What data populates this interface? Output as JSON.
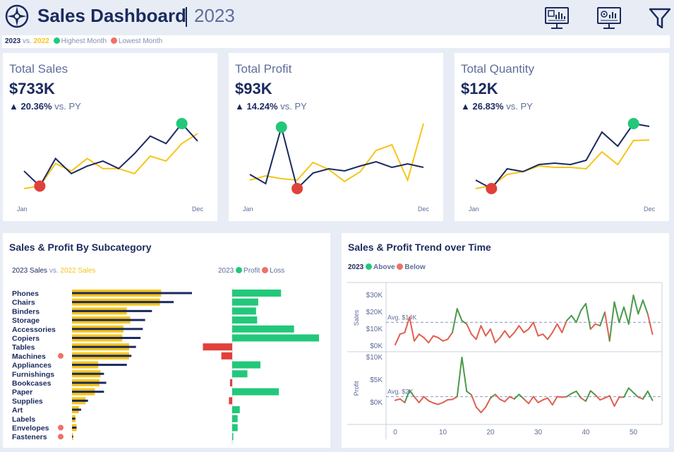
{
  "header": {
    "title": "Sales Dashboard",
    "year": "2023",
    "icons": [
      "compass-logo-icon",
      "dashboard-monitor-icon",
      "settings-monitor-icon",
      "filter-icon"
    ]
  },
  "legend": {
    "current": "2023",
    "vs": "vs.",
    "previous": "2022",
    "highest": "Highest Month",
    "lowest": "Lowest Month"
  },
  "colors": {
    "navy": "#1b2a5e",
    "yellow": "#f5c518",
    "green": "#22c87a",
    "red": "#e0413a",
    "trend_green": "#4a9a4a",
    "trend_red": "#e06050"
  },
  "kpis": [
    {
      "title": "Total Sales",
      "value": "$733K",
      "change_arrow": "▲",
      "change": "20.36%",
      "vs": "vs. PY",
      "start_label": "Jan",
      "end_label": "Dec",
      "cy": [
        3.1,
        2.5,
        3.6,
        3.0,
        3.3,
        3.5,
        3.2,
        3.8,
        4.5,
        4.2,
        5.0,
        4.3
      ],
      "py": [
        2.4,
        2.5,
        3.4,
        3.1,
        3.6,
        3.2,
        3.2,
        3.0,
        3.7,
        3.5,
        4.2,
        4.6
      ],
      "high": 10,
      "low": 1
    },
    {
      "title": "Total Profit",
      "value": "$93K",
      "change_arrow": "▲",
      "change": "14.24%",
      "vs": "vs. PY",
      "start_label": "Jan",
      "end_label": "Dec",
      "cy": [
        3.8,
        2.5,
        10.5,
        1.8,
        4.0,
        4.6,
        4.3,
        5.0,
        5.6,
        4.8,
        5.3,
        4.8
      ],
      "py": [
        3.0,
        3.6,
        3.2,
        3.0,
        5.5,
        4.5,
        2.8,
        4.2,
        7.2,
        8.0,
        3.0,
        11.0
      ],
      "high": 2,
      "low": 3
    },
    {
      "title": "Total Quantity",
      "value": "$12K",
      "change_arrow": "▲",
      "change": "26.83%",
      "vs": "vs. PY",
      "start_label": "Jan",
      "end_label": "Dec",
      "cy": [
        1.2,
        0.9,
        1.6,
        1.5,
        1.75,
        1.8,
        1.75,
        1.9,
        2.9,
        2.4,
        3.2,
        3.1
      ],
      "py": [
        0.9,
        1.0,
        1.4,
        1.5,
        1.7,
        1.65,
        1.65,
        1.6,
        2.2,
        1.75,
        2.6,
        2.62
      ],
      "high": 10,
      "low": 1
    }
  ],
  "subcategory": {
    "title": "Sales & Profit By Subcategory",
    "sales_legend": {
      "current": "2023 Sales",
      "vs": "vs.",
      "previous": "2022 Sales"
    },
    "profit_legend": {
      "year": "2023",
      "profit": "Profit",
      "loss": "Loss"
    },
    "items": [
      {
        "name": "Phones",
        "s23": 105,
        "s22": 78,
        "profit": 45,
        "flag": false
      },
      {
        "name": "Chairs",
        "s23": 89,
        "s22": 77,
        "profit": 24,
        "flag": false
      },
      {
        "name": "Binders",
        "s23": 70,
        "s22": 48,
        "profit": 22,
        "flag": false
      },
      {
        "name": "Storage",
        "s23": 64,
        "s22": 51,
        "profit": 23,
        "flag": false
      },
      {
        "name": "Accessories",
        "s23": 62,
        "s22": 45,
        "profit": 57,
        "flag": false
      },
      {
        "name": "Copiers",
        "s23": 60,
        "s22": 44,
        "profit": 80,
        "flag": false
      },
      {
        "name": "Tables",
        "s23": 56,
        "s22": 50,
        "profit": -27,
        "flag": false
      },
      {
        "name": "Machines",
        "s23": 52,
        "s22": 50,
        "profit": -10,
        "flag": true
      },
      {
        "name": "Appliances",
        "s23": 48,
        "s22": 23,
        "profit": 26,
        "flag": false
      },
      {
        "name": "Furnishings",
        "s23": 28,
        "s22": 25,
        "profit": 14,
        "flag": false
      },
      {
        "name": "Bookcases",
        "s23": 30,
        "s22": 24,
        "profit": -2,
        "flag": false
      },
      {
        "name": "Paper",
        "s23": 28,
        "s22": 20,
        "profit": 43,
        "flag": false
      },
      {
        "name": "Supplies",
        "s23": 14,
        "s22": 12,
        "profit": -3,
        "flag": false
      },
      {
        "name": "Art",
        "s23": 8,
        "s22": 6,
        "profit": 7,
        "flag": false
      },
      {
        "name": "Labels",
        "s23": 3,
        "s22": 3,
        "profit": 5,
        "flag": false
      },
      {
        "name": "Envelopes",
        "s23": 4,
        "s22": 4,
        "profit": 5,
        "flag": true
      },
      {
        "name": "Fasteners",
        "s23": 1,
        "s22": 1,
        "profit": 1,
        "flag": true
      }
    ]
  },
  "trend": {
    "title": "Sales & Profit Trend over Time",
    "legend": {
      "year": "2023",
      "above": "Above",
      "below": "Below"
    },
    "sales_axis_label": "Sales",
    "profit_axis_label": "Profit",
    "sales_ticks": [
      "$30K",
      "$20K",
      "$10K",
      "$0K"
    ],
    "profit_ticks": [
      "$10K",
      "$5K",
      "$0K"
    ],
    "x_ticks": [
      "0",
      "10",
      "20",
      "30",
      "40",
      "50"
    ],
    "sales_avg_label": "Avg. $14K",
    "profit_avg_label": "Avg. $2K",
    "sales_avg": 14,
    "profit_avg": 1.3,
    "sales": [
      0.8,
      7,
      8,
      17,
      3,
      7,
      5,
      2,
      6,
      5,
      3,
      4,
      8,
      22,
      15,
      13,
      7,
      4,
      12,
      6,
      10,
      2,
      5,
      9,
      5,
      8,
      12,
      8,
      10,
      14,
      6,
      7,
      4,
      8,
      13,
      8,
      15,
      18,
      14,
      21,
      25,
      10,
      13,
      12,
      20,
      3,
      26,
      14,
      23,
      13,
      30,
      19,
      27,
      19,
      7
    ],
    "profit": [
      0.5,
      0.8,
      0,
      2.7,
      1.3,
      0,
      1.3,
      0.4,
      -0.1,
      -0.4,
      0,
      0.6,
      0.7,
      1.3,
      10,
      2.5,
      1.7,
      -1,
      -2.2,
      -1,
      1,
      1.8,
      0.7,
      0.2,
      1.3,
      0.8,
      1.8,
      0.8,
      -0.2,
      1.3,
      0,
      0.6,
      1,
      -0.5,
      1.3,
      1.2,
      1.3,
      2,
      2.5,
      1,
      0.3,
      2.6,
      1.7,
      0.6,
      1,
      1.5,
      -0.8,
      1.2,
      1.2,
      3.2,
      2.2,
      1.2,
      0.8,
      2.5,
      0.5
    ]
  }
}
